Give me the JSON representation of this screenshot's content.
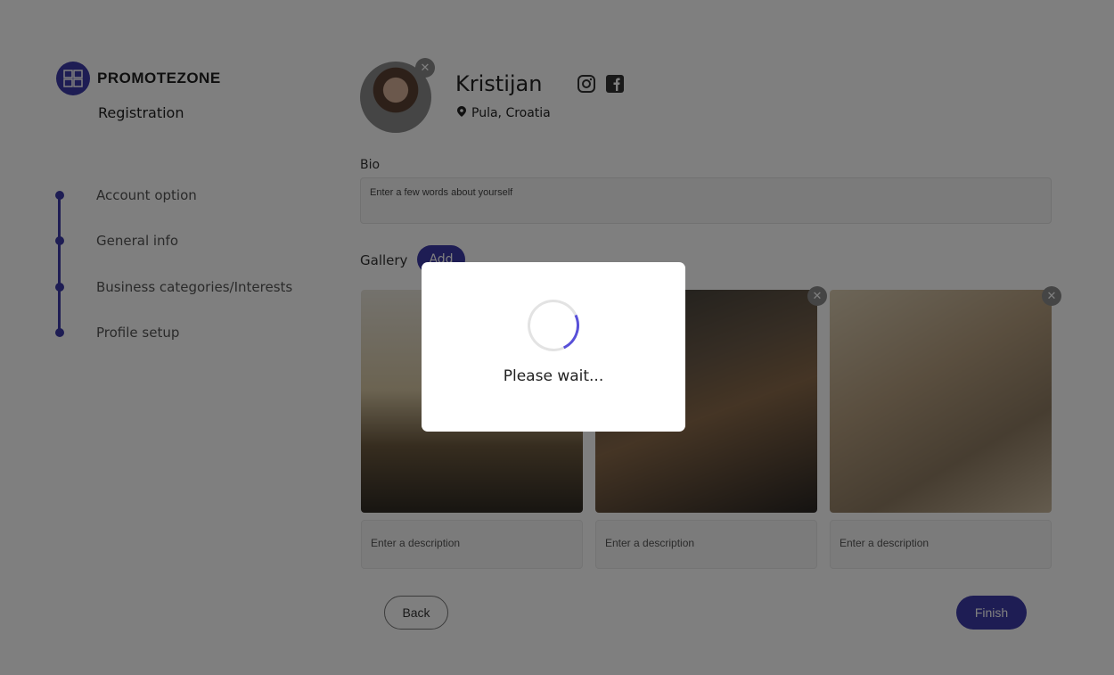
{
  "brand": {
    "name": "PROMOTEZONE",
    "subtitle": "Registration",
    "logo_icon": "promotezone-logo-icon",
    "accent_color": "#3d3aa8"
  },
  "steps": [
    {
      "label": "Account option"
    },
    {
      "label": "General info"
    },
    {
      "label": "Business categories/Interests"
    },
    {
      "label": "Profile setup"
    }
  ],
  "profile": {
    "name": "Kristijan",
    "location": "Pula, Croatia",
    "social_icons": [
      "instagram-icon",
      "facebook-icon"
    ]
  },
  "bio": {
    "label": "Bio",
    "placeholder": "Enter a few words about yourself"
  },
  "gallery": {
    "label": "Gallery",
    "add_label": "Add",
    "items": [
      {
        "description_placeholder": "Enter a description"
      },
      {
        "description_placeholder": "Enter a description"
      },
      {
        "description_placeholder": "Enter a description"
      }
    ]
  },
  "actions": {
    "back_label": "Back",
    "finish_label": "Finish"
  },
  "loading": {
    "text": "Please wait..."
  }
}
